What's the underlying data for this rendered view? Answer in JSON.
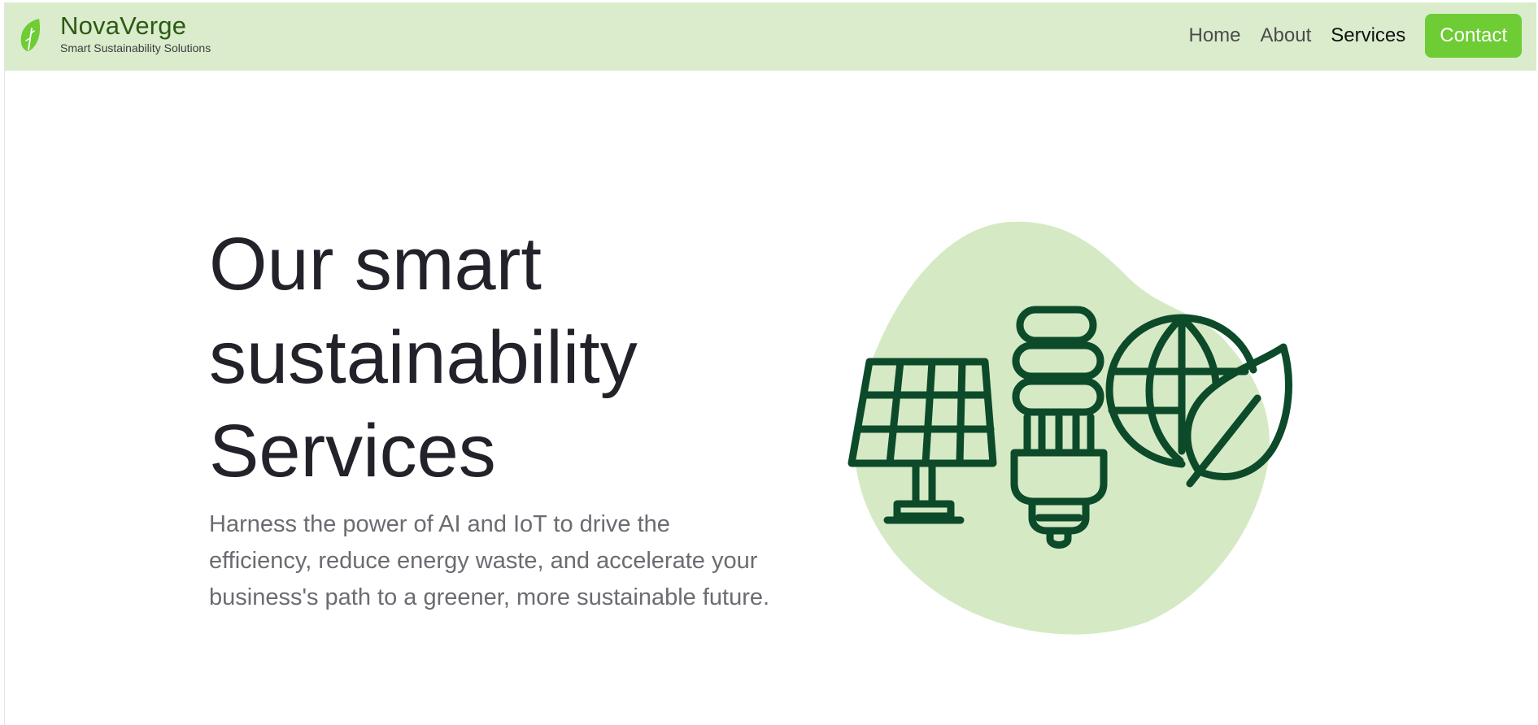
{
  "brand": {
    "name": "NovaVerge",
    "tagline": "Smart Sustainability Solutions",
    "logo_icon": "leaf-logo-icon"
  },
  "nav": {
    "items": [
      {
        "label": "Home",
        "active": false
      },
      {
        "label": "About",
        "active": false
      },
      {
        "label": "Services",
        "active": true
      }
    ],
    "contact_label": "Contact"
  },
  "hero": {
    "title_lines": [
      "Our smart",
      "sustainability",
      "Services"
    ],
    "description": "Harness the power of AI and IoT to drive the efficiency, reduce energy waste, and accelerate your business's path to a greener, more sustainable future."
  },
  "illustration": {
    "icons": [
      "solar-panel-icon",
      "lightbulb-icon",
      "globe-leaf-icon"
    ]
  },
  "colors": {
    "navbar_bg": "#daeccc",
    "brand_green": "#2b5a13",
    "accent": "#6ecc35",
    "blob": "#d5eac4",
    "icon_stroke": "#0c4a2a"
  }
}
